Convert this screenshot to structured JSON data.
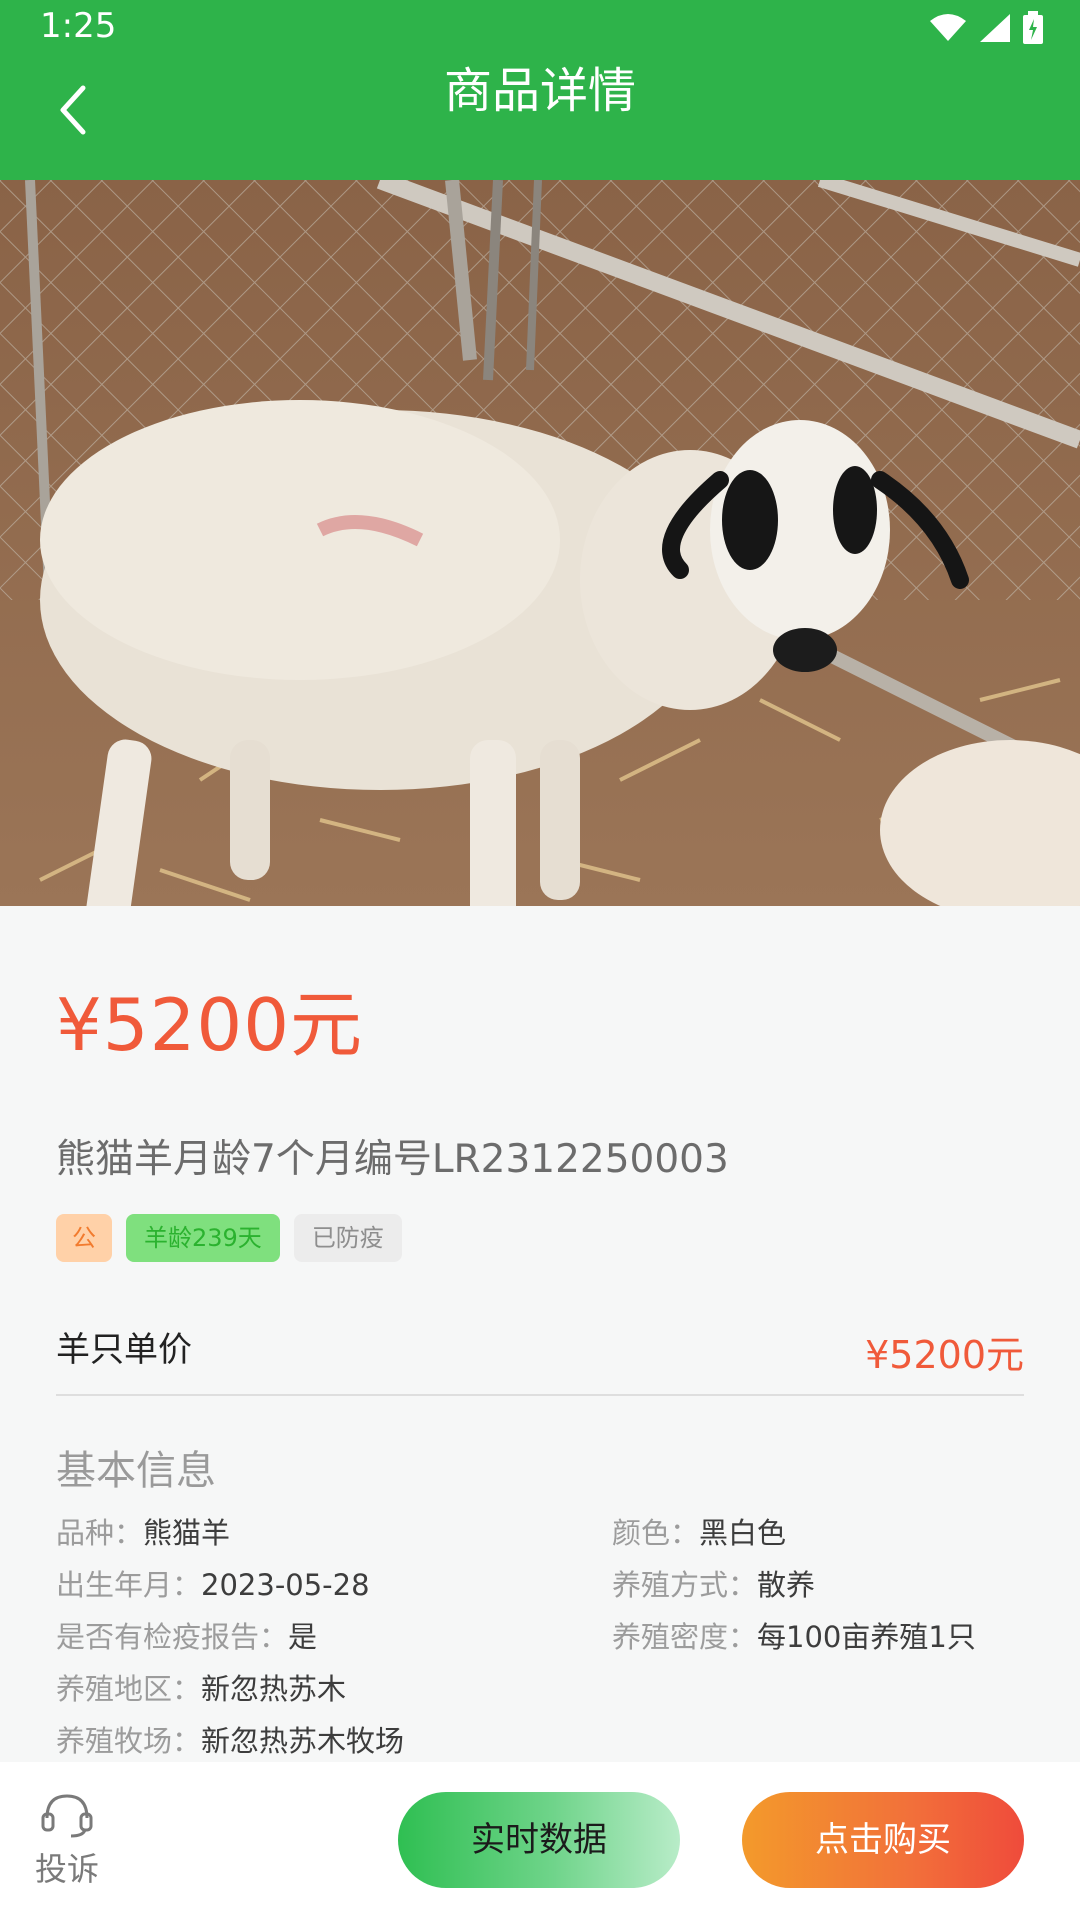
{
  "status_bar": {
    "time": "1:25",
    "icons": [
      "wifi-icon",
      "signal-icon",
      "battery-icon"
    ]
  },
  "header": {
    "title": "商品详情",
    "back_icon": "chevron-left-icon",
    "background_color": "#2eb34a"
  },
  "hero": {
    "image_subject": "sheep-photo"
  },
  "product": {
    "price": "¥5200元",
    "title": "熊猫羊月龄7个月编号LR2312250003",
    "tags": {
      "gender": "公",
      "age": "羊龄239天",
      "vaccine": "已防疫"
    },
    "unit_price_label": "羊只单价",
    "unit_price_value": "¥5200元",
    "price_color": "#f05a3a"
  },
  "basic_info": {
    "section_title": "基本信息",
    "breed_label": "品种：",
    "breed_value": "熊猫羊",
    "color_label": "颜色：",
    "color_value": "黑白色",
    "birth_label": "出生年月：",
    "birth_value": "2023-05-28",
    "method_label": "养殖方式：",
    "method_value": "散养",
    "quarantine_label": "是否有检疫报告：",
    "quarantine_value": "是",
    "density_label": "养殖密度：",
    "density_value": "每100亩养殖1只",
    "region_label": "养殖地区：",
    "region_value": "新忽热苏木",
    "ranch_label": "养殖牧场：",
    "ranch_value": "新忽热苏木牧场"
  },
  "bottom_bar": {
    "complaint_label": "投诉",
    "complaint_icon": "headset-icon",
    "realtime_button": "实时数据",
    "buy_button": "点击购买"
  }
}
